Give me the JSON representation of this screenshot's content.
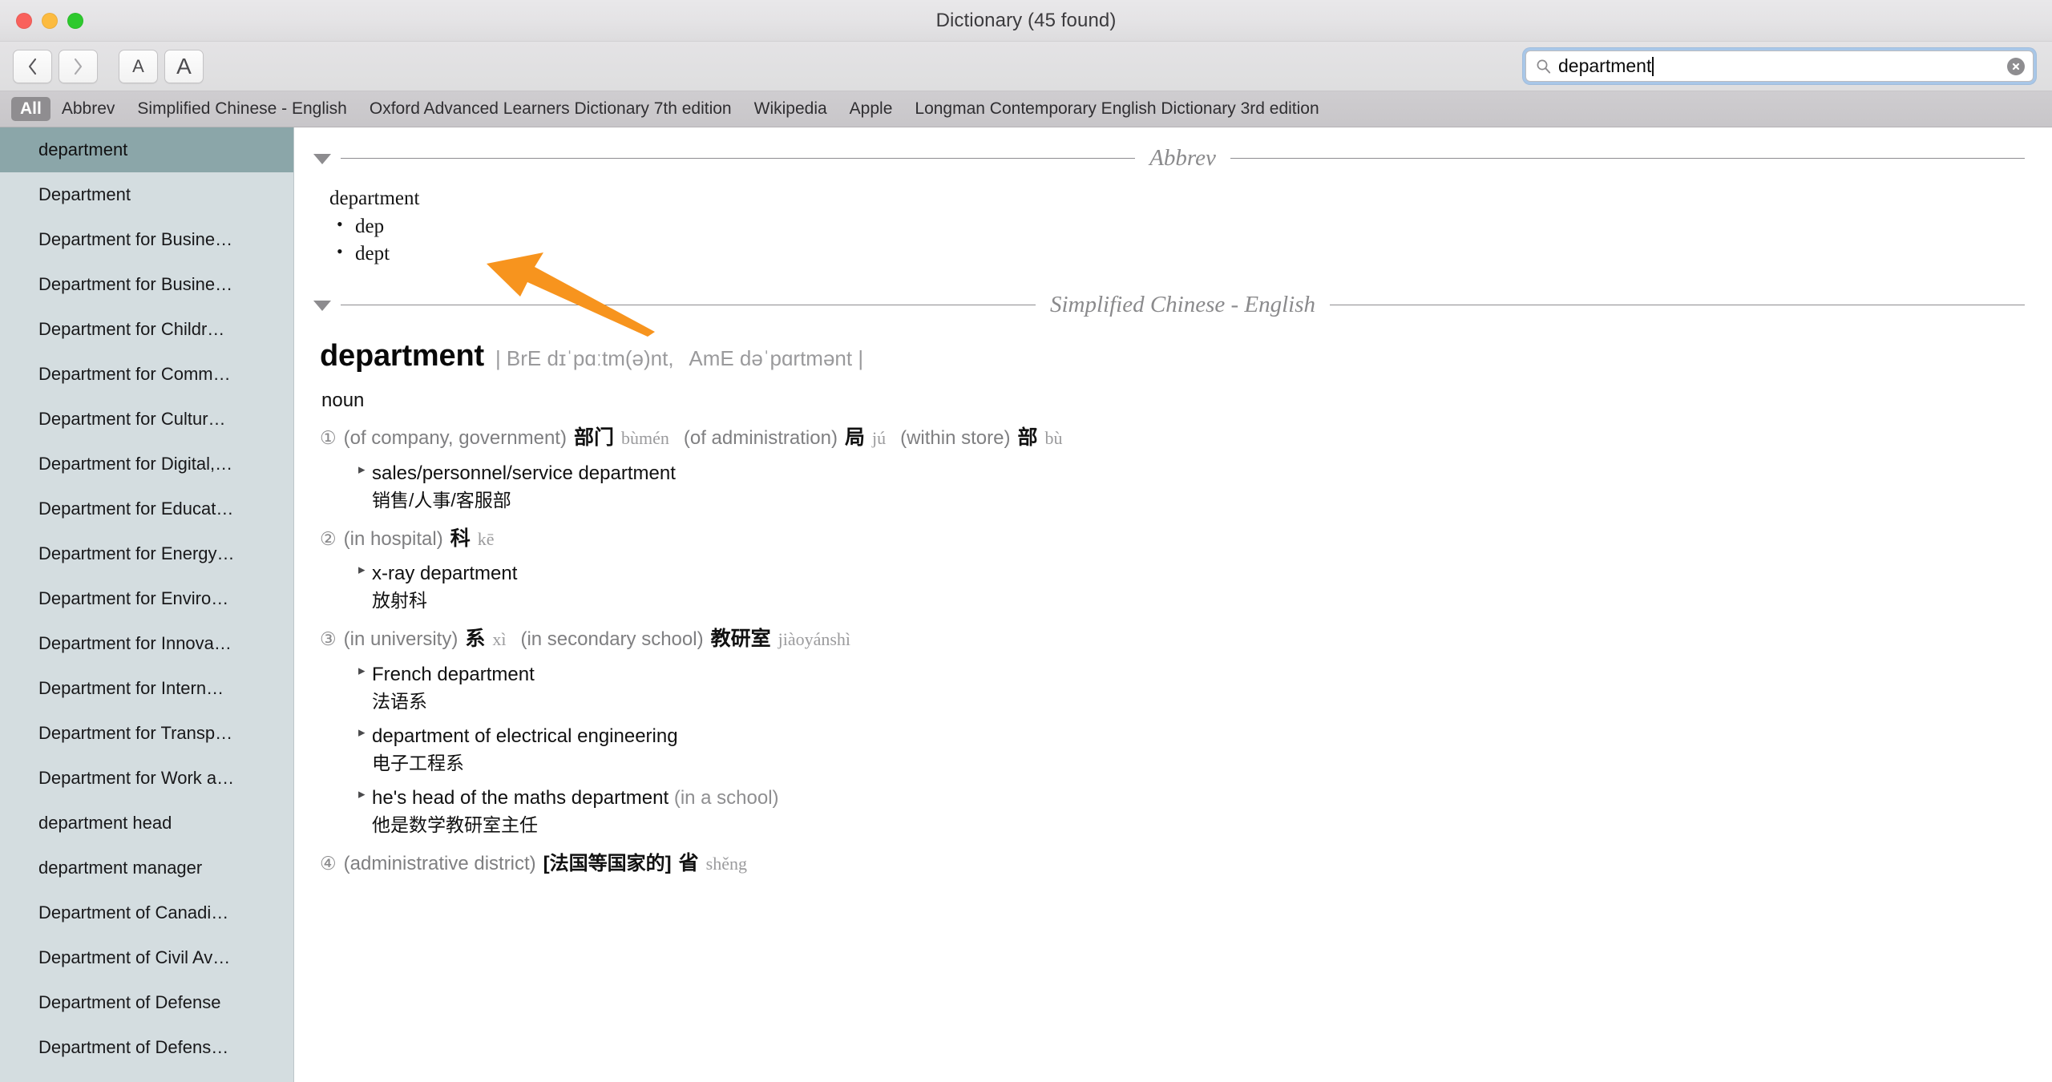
{
  "window": {
    "title": "Dictionary (45 found)",
    "traffic_lights": [
      "close",
      "minimize",
      "zoom"
    ]
  },
  "toolbar": {
    "back_icon": "chevron-left-icon",
    "forward_icon": "chevron-right-icon",
    "text_smaller_label": "A",
    "text_larger_label": "A",
    "search": {
      "value": "department",
      "placeholder": "Search",
      "search_icon": "search-icon",
      "clear_icon": "clear-icon"
    }
  },
  "tabs": [
    {
      "label": "All",
      "active": true
    },
    {
      "label": "Abbrev",
      "active": false
    },
    {
      "label": "Simplified Chinese - English",
      "active": false
    },
    {
      "label": "Oxford Advanced Learners Dictionary 7th edition",
      "active": false
    },
    {
      "label": "Wikipedia",
      "active": false
    },
    {
      "label": "Apple",
      "active": false
    },
    {
      "label": "Longman Contemporary English Dictionary 3rd edition",
      "active": false
    }
  ],
  "sidebar": {
    "items": [
      {
        "label": "department",
        "selected": true
      },
      {
        "label": "Department",
        "selected": false
      },
      {
        "label": "Department for Busine…",
        "selected": false
      },
      {
        "label": "Department for Busine…",
        "selected": false
      },
      {
        "label": "Department for Childr…",
        "selected": false
      },
      {
        "label": "Department for Comm…",
        "selected": false
      },
      {
        "label": "Department for Cultur…",
        "selected": false
      },
      {
        "label": "Department for Digital,…",
        "selected": false
      },
      {
        "label": "Department for Educat…",
        "selected": false
      },
      {
        "label": "Department for Energy…",
        "selected": false
      },
      {
        "label": "Department for Enviro…",
        "selected": false
      },
      {
        "label": "Department for Innova…",
        "selected": false
      },
      {
        "label": "Department for Intern…",
        "selected": false
      },
      {
        "label": "Department for Transp…",
        "selected": false
      },
      {
        "label": "Department for Work a…",
        "selected": false
      },
      {
        "label": "department head",
        "selected": false
      },
      {
        "label": "department manager",
        "selected": false
      },
      {
        "label": "Department of Canadi…",
        "selected": false
      },
      {
        "label": "Department of Civil Av…",
        "selected": false
      },
      {
        "label": "Department of Defense",
        "selected": false
      },
      {
        "label": "Department of Defens…",
        "selected": false
      }
    ]
  },
  "content": {
    "sections": [
      {
        "title": "Abbrev",
        "disclosure_icon": "triangle-down-icon",
        "abbrev": {
          "headword": "department",
          "items": [
            "dep",
            "dept"
          ]
        }
      },
      {
        "title": "Simplified Chinese - English",
        "disclosure_icon": "triangle-down-icon",
        "entry": {
          "headword": "department",
          "ipa": "| BrE dɪˈpɑːtm(ə)nt,  AmE dəˈpɑrtmənt |",
          "pos": "noun",
          "senses": [
            {
              "num": "①",
              "parts": [
                {
                  "type": "gloss",
                  "text": "(of company, government)"
                },
                {
                  "type": "hanzi",
                  "text": "部门"
                },
                {
                  "type": "pinyin",
                  "text": "bùmén"
                },
                {
                  "type": "gloss",
                  "text": "(of administration)"
                },
                {
                  "type": "hanzi",
                  "text": "局"
                },
                {
                  "type": "pinyin",
                  "text": "jú"
                },
                {
                  "type": "gloss",
                  "text": "(within store)"
                },
                {
                  "type": "hanzi",
                  "text": "部"
                },
                {
                  "type": "pinyin",
                  "text": "bù"
                }
              ],
              "examples": [
                {
                  "en": "sales/personnel/service department",
                  "note": "",
                  "zh": "销售/人事/客服部"
                }
              ]
            },
            {
              "num": "②",
              "parts": [
                {
                  "type": "gloss",
                  "text": "(in hospital)"
                },
                {
                  "type": "hanzi",
                  "text": "科"
                },
                {
                  "type": "pinyin",
                  "text": "kē"
                }
              ],
              "examples": [
                {
                  "en": "x-ray department",
                  "note": "",
                  "zh": "放射科"
                }
              ]
            },
            {
              "num": "③",
              "parts": [
                {
                  "type": "gloss",
                  "text": "(in university)"
                },
                {
                  "type": "hanzi",
                  "text": "系"
                },
                {
                  "type": "pinyin",
                  "text": "xì"
                },
                {
                  "type": "gloss",
                  "text": "(in secondary school)"
                },
                {
                  "type": "hanzi",
                  "text": "教研室"
                },
                {
                  "type": "pinyin",
                  "text": "jiàoyánshì"
                }
              ],
              "examples": [
                {
                  "en": "French department",
                  "note": "",
                  "zh": "法语系"
                },
                {
                  "en": "department of electrical engineering",
                  "note": "",
                  "zh": "电子工程系"
                },
                {
                  "en": "he's head of the maths department",
                  "note": "(in a school)",
                  "zh": "他是数学教研室主任"
                }
              ]
            },
            {
              "num": "④",
              "parts": [
                {
                  "type": "gloss",
                  "text": "(administrative district)"
                },
                {
                  "type": "bracket",
                  "text": "[法国等国家的]"
                },
                {
                  "type": "hanzi",
                  "text": "省"
                },
                {
                  "type": "pinyin",
                  "text": "shěng"
                }
              ],
              "examples": []
            }
          ]
        }
      }
    ]
  },
  "annotation": {
    "arrow_icon": "orange-arrow-icon",
    "color": "#F7941E"
  },
  "colors": {
    "sidebar_bg": "#d4dde0",
    "sidebar_selected": "#8ba6a9",
    "tabbar_bg": "#c8c6c9",
    "tab_active_bg": "#8f8d90",
    "accent_orange": "#F7941E",
    "search_focus_ring": "#a8c7e8"
  }
}
